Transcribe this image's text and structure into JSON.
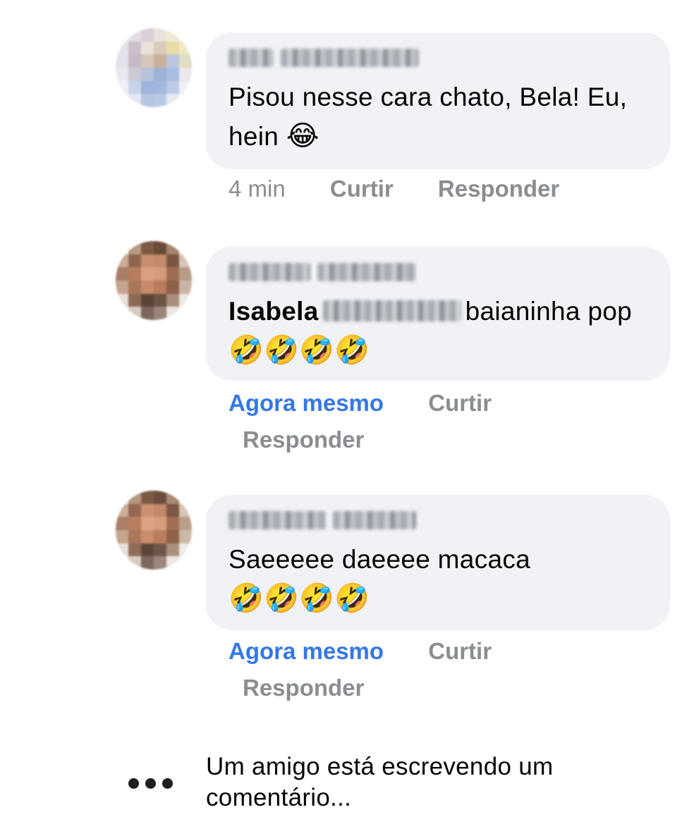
{
  "comments": [
    {
      "text": "Pisou nesse cara chato, Bela! Eu, hein",
      "emoji": "😂",
      "time": "4 min",
      "like": "Curtir",
      "reply": "Responder"
    },
    {
      "mention": "Isabela",
      "text_after_mention": "baianinha pop",
      "emojis": "🤣🤣🤣🤣",
      "time": "Agora mesmo",
      "like": "Curtir",
      "reply": "Responder"
    },
    {
      "text": "Saeeeee daeeee macaca",
      "emojis": "🤣🤣🤣🤣",
      "time": "Agora mesmo",
      "like": "Curtir",
      "reply": "Responder"
    }
  ],
  "typing": {
    "text": "Um amigo está escrevendo um comentário..."
  },
  "colors": {
    "bubble": "#f0f2f5",
    "action_gray": "#8a8d91",
    "link_blue": "#3578e5"
  }
}
